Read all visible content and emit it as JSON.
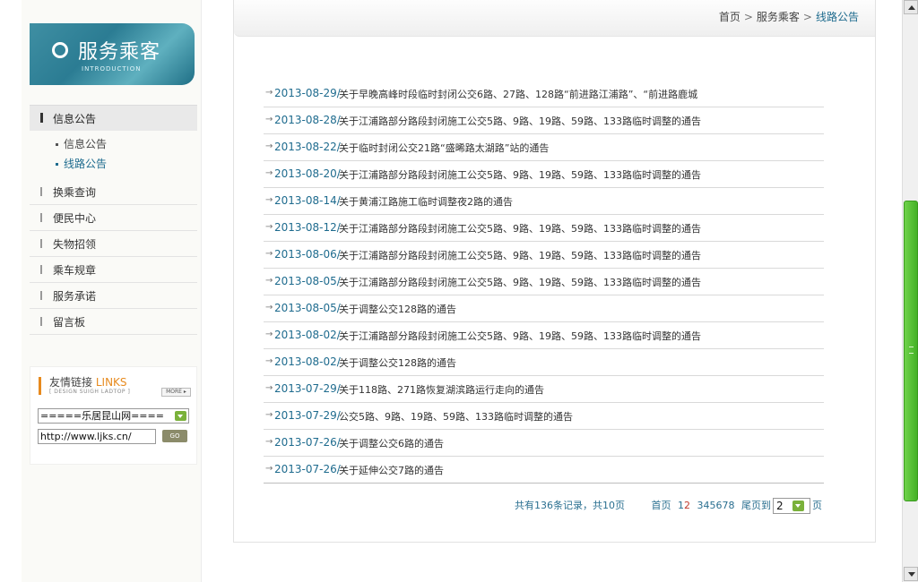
{
  "sidebar": {
    "banner_title": "服务乘客",
    "banner_subtitle": "INTRODUCTION",
    "active_section": "信息公告",
    "sub_items": [
      {
        "label": "信息公告",
        "current": false
      },
      {
        "label": "线路公告",
        "current": true
      }
    ],
    "menu_items": [
      {
        "label": "换乘查询"
      },
      {
        "label": "便民中心"
      },
      {
        "label": "失物招领"
      },
      {
        "label": "乘车规章"
      },
      {
        "label": "服务承诺"
      },
      {
        "label": "留言板"
      }
    ],
    "links": {
      "title_cn": "友情链接",
      "title_en": "LINKS",
      "subtitle": "[ DESIGN SUIGH LADTOP ]",
      "more_label": "MORE ▸",
      "select_value": "=====乐居昆山网====",
      "input_value": "http://www.ljks.cn/",
      "go_label": "GO"
    }
  },
  "breadcrumb": {
    "home": "首页",
    "section": "服务乘客",
    "current": "线路公告",
    "separator": ">"
  },
  "notices": [
    {
      "date": "2013-08-29/",
      "title": "关于早晚高峰时段临时封闭公交6路、27路、128路“前进路江浦路”、“前进路鹿城"
    },
    {
      "date": "2013-08-28/",
      "title": "关于江浦路部分路段封闭施工公交5路、9路、19路、59路、133路临时调整的通告"
    },
    {
      "date": "2013-08-22/",
      "title": "关于临时封闭公交21路“盛晞路太湖路”站的通告"
    },
    {
      "date": "2013-08-20/",
      "title": "关于江浦路部分路段封闭施工公交5路、9路、19路、59路、133路临时调整的通告"
    },
    {
      "date": "2013-08-14/",
      "title": "关于黄浦江路施工临时调整夜2路的通告"
    },
    {
      "date": "2013-08-12/",
      "title": "关于江浦路部分路段封闭施工公交5路、9路、19路、59路、133路临时调整的通告"
    },
    {
      "date": "2013-08-06/",
      "title": "关于江浦路部分路段封闭施工公交5路、9路、19路、59路、133路临时调整的通告"
    },
    {
      "date": "2013-08-05/",
      "title": "关于江浦路部分路段封闭施工公交5路、9路、19路、59路、133路临时调整的通告"
    },
    {
      "date": "2013-08-05/",
      "title": "关于调整公交128路的通告"
    },
    {
      "date": "2013-08-02/",
      "title": "关于江浦路部分路段封闭施工公交5路、9路、19路、59路、133路临时调整的通告"
    },
    {
      "date": "2013-08-02/",
      "title": "关于调整公交128路的通告"
    },
    {
      "date": "2013-07-29/",
      "title": "关于118路、271路恢复湖滨路运行走向的通告"
    },
    {
      "date": "2013-07-29/",
      "title": "公交5路、9路、19路、59路、133路临时调整的通告"
    },
    {
      "date": "2013-07-26/",
      "title": "关于调整公交6路的通告"
    },
    {
      "date": "2013-07-26/",
      "title": "关于延伸公交7路的通告"
    }
  ],
  "pager": {
    "summary": "共有136条记录，共10页",
    "first": "首页",
    "pages": [
      "1",
      "2",
      "3",
      "4",
      "5",
      "6",
      "7",
      "8"
    ],
    "current_page": "2",
    "last": "尾页到",
    "select_value": "2",
    "page_suffix": "页"
  },
  "colors": {
    "link_blue": "#1e6b8e",
    "accent_orange": "#e78a1e",
    "scroll_green": "#44b126"
  }
}
